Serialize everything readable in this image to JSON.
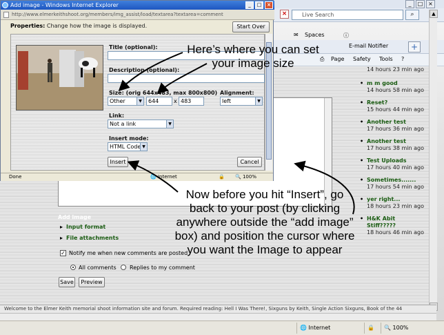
{
  "popup": {
    "title": "Add image - Windows Internet Explorer",
    "url": "http://www.elmerkeithshoot.org/members/img_assist/load/textarea?textarea=comment",
    "properties_label": "Properties:",
    "properties_text": "Change how the image is displayed.",
    "start_over": "Start Over",
    "title_label": "Title (optional):",
    "description_label": "Description (optional):",
    "size_label": "Size: (orig 644x483, max 800x800)",
    "size_preset": "Other",
    "width": "644",
    "height": "483",
    "x_sep": "x",
    "alignment_label": "Alignment:",
    "alignment_value": "left",
    "link_label": "Link:",
    "link_value": "Not a link",
    "insert_mode_label": "Insert mode:",
    "insert_mode_value": "HTML Code",
    "insert_button": "Insert",
    "cancel_button": "Cancel",
    "status_done": "Done",
    "status_zone": "Internet",
    "status_zoom": "100%"
  },
  "browser": {
    "search_placeholder": "Live Search",
    "links": [
      "Spaces",
      "E-mail Notifier"
    ],
    "menu": [
      "Page",
      "Safety",
      "Tools"
    ],
    "recent_posts": [
      {
        "title": "",
        "age": "14 hours 23 min ago"
      },
      {
        "title": "m m good",
        "age": "14 hours 58 min ago"
      },
      {
        "title": "Reset?",
        "age": "15 hours 44 min ago"
      },
      {
        "title": "Another test",
        "age": "17 hours 36 min ago"
      },
      {
        "title": "Another test",
        "age": "17 hours 38 min ago"
      },
      {
        "title": "Test Uploads",
        "age": "17 hours 40 min ago"
      },
      {
        "title": "Sometimes.......",
        "age": "17 hours 54 min ago"
      },
      {
        "title": "yer right...",
        "age": "18 hours 23 min ago"
      },
      {
        "title": "H&K Abit Stiff?????",
        "age": "18 hours 46 min ago"
      }
    ],
    "add_image": "Add image",
    "input_format": "Input format",
    "file_attachments": "File attachments",
    "notify_label": "Notify me when new comments are posted",
    "all_comments": "All comments",
    "replies_only": "Replies to my comment",
    "save_button": "Save",
    "preview_button": "Preview",
    "welcome_text": "Welcome to the Elmer Keith memorial shoot information site and forum. Required reading: Hell I Was There!, Sixguns by Keith, Single Action Sixguns, Book of the 44",
    "status_zone": "Internet",
    "status_zoom": "100%"
  },
  "annotations": {
    "top": "Here’s where you can set your image size",
    "bottom": "Now before you hit “Insert”, go back to your post (by clicking anywhere outside the “add image” box) and position the cursor where you want the Image to appear"
  }
}
